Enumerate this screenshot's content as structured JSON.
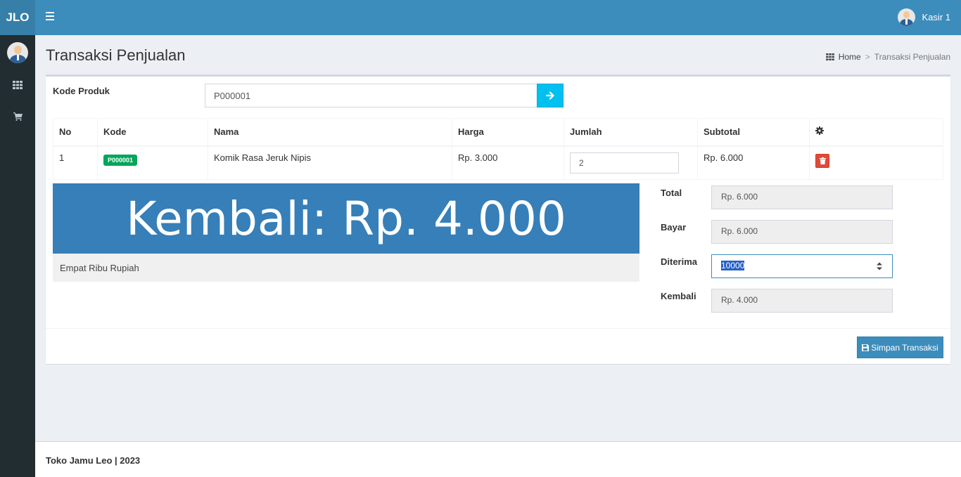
{
  "app": {
    "logo": "JLO"
  },
  "header": {
    "user_name": "Kasir 1"
  },
  "sidebar": {
    "icons": [
      "dashboard-grid-icon",
      "cart-icon"
    ]
  },
  "page": {
    "title": "Transaksi Penjualan",
    "breadcrumb": {
      "home": "Home",
      "separator": ">",
      "current": "Transaksi Penjualan"
    }
  },
  "form": {
    "kode_label": "Kode Produk",
    "kode_value": "P000001"
  },
  "table": {
    "headers": [
      "No",
      "Kode",
      "Nama",
      "Harga",
      "Jumlah",
      "Subtotal"
    ],
    "rows": [
      {
        "no": "1",
        "kode": "P000001",
        "nama": "Komik Rasa Jeruk Nipis",
        "harga": "Rp. 3.000",
        "jumlah": "2",
        "subtotal": "Rp. 6.000"
      }
    ]
  },
  "display": {
    "kembali": "Kembali: Rp. 4.000",
    "terbilang": "Empat Ribu Rupiah"
  },
  "summary": {
    "total_label": "Total",
    "total_value": "Rp. 6.000",
    "bayar_label": "Bayar",
    "bayar_value": "Rp. 6.000",
    "diterima_label": "Diterima",
    "diterima_value": "10000",
    "kembali_label": "Kembali",
    "kembali_value": "Rp. 4.000"
  },
  "actions": {
    "save_label": "Simpan Transaksi"
  },
  "footer": {
    "text": "Toko Jamu Leo | 2023"
  },
  "colors": {
    "header": "#3c8dbc",
    "logo": "#367fa9",
    "sidebar": "#222d32",
    "panel": "#367fb9",
    "success": "#00a65a",
    "danger": "#dd4b39",
    "info": "#00c0ef"
  }
}
